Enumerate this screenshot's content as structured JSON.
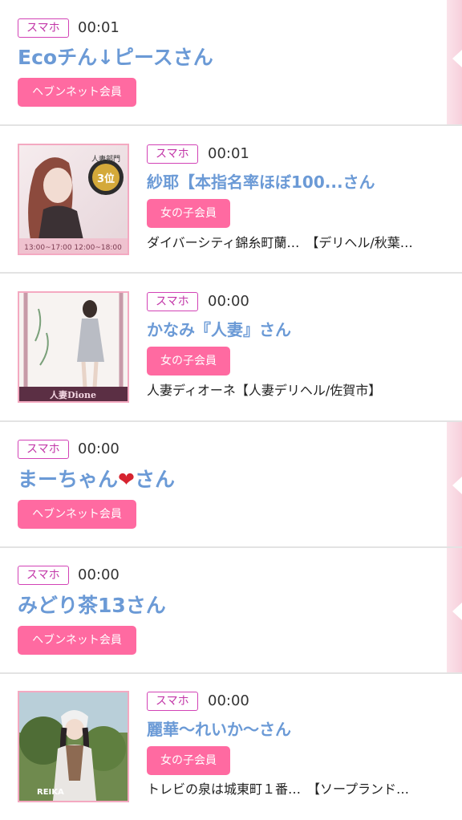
{
  "items": [
    {
      "badge": "スマホ",
      "time": "00:01",
      "name": "Ecoチん↓ピースさん",
      "member": "ヘブンネット会員",
      "has_thumb": false
    },
    {
      "badge": "スマホ",
      "time": "00:01",
      "name": "紗耶【本指名率ほぼ100...さん",
      "member": "女の子会員",
      "shop": "ダイバーシティ錦糸町蘭…　【デリヘル/秋葉…",
      "has_thumb": true,
      "thumb_icon": "profile-photo-icon"
    },
    {
      "badge": "スマホ",
      "time": "00:00",
      "name": "かなみ『人妻』さん",
      "member": "女の子会員",
      "shop": "人妻ディオーネ【人妻デリヘル/佐賀市】",
      "has_thumb": true,
      "thumb_icon": "profile-photo-icon"
    },
    {
      "badge": "スマホ",
      "time": "00:00",
      "name_prefix": "まーちゃん",
      "name_emoji": "❤",
      "name_suffix": "さん",
      "member": "ヘブンネット会員",
      "has_thumb": false
    },
    {
      "badge": "スマホ",
      "time": "00:00",
      "name": "みどり茶13さん",
      "member": "ヘブンネット会員",
      "has_thumb": false
    },
    {
      "badge": "スマホ",
      "time": "00:00",
      "name": "麗華〜れいか〜さん",
      "member": "女の子会員",
      "shop": "トレビの泉は城東町１番…　【ソープランド…",
      "has_thumb": true,
      "thumb_icon": "profile-photo-icon"
    }
  ],
  "thumb_text": {
    "t1_top": "人妻部門",
    "t1_rank": "3位",
    "t1_hours": "13:00~17:00 12:00~18:00",
    "t2_logo": "人妻Dione",
    "t3_logo": "REIKA"
  },
  "colors": {
    "name": "#6b9ad6",
    "badge_border": "#d243b6",
    "pill": "#ff6aa1",
    "thumb_border": "#f4a9c1"
  }
}
